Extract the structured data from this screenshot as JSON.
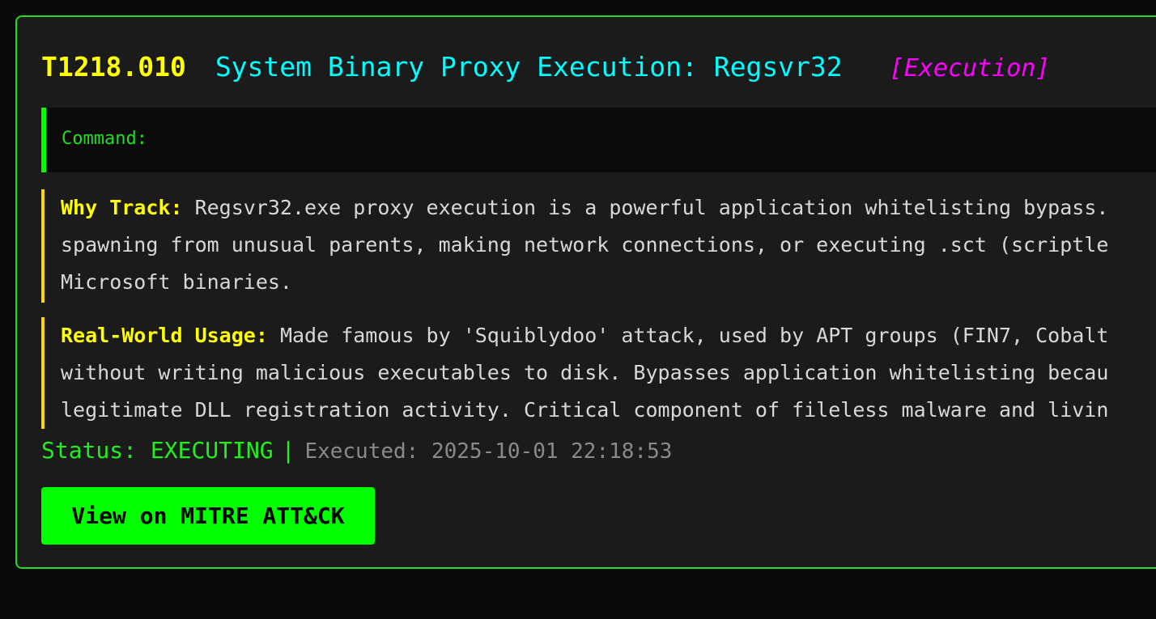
{
  "technique": {
    "id": "T1218.010",
    "name": "System Binary Proxy Execution: Regsvr32",
    "tactic": "[Execution]"
  },
  "command": {
    "label": "Command:"
  },
  "why_track": {
    "label": "Why Track:",
    "lines": [
      "Regsvr32.exe proxy execution is a powerful application whitelisting bypass.",
      "spawning from unusual parents, making network connections, or executing .sct (scriptle",
      "Microsoft binaries."
    ]
  },
  "real_world": {
    "label": "Real-World Usage:",
    "lines": [
      "Made famous by 'Squiblydoo' attack, used by APT groups (FIN7, Cobalt",
      "without writing malicious executables to disk. Bypasses application whitelisting becau",
      "legitimate DLL registration activity. Critical component of fileless malware and livin"
    ]
  },
  "status": {
    "label": "Status: EXECUTING",
    "separator": "|",
    "executed": "Executed: 2025-10-01 22:18:53"
  },
  "button": {
    "label": "View on MITRE ATT&CK"
  },
  "colors": {
    "accent": "#00ff00",
    "technique_id": "#ffff00",
    "technique_name": "#00ffff",
    "tactic": "#ff00ff"
  }
}
